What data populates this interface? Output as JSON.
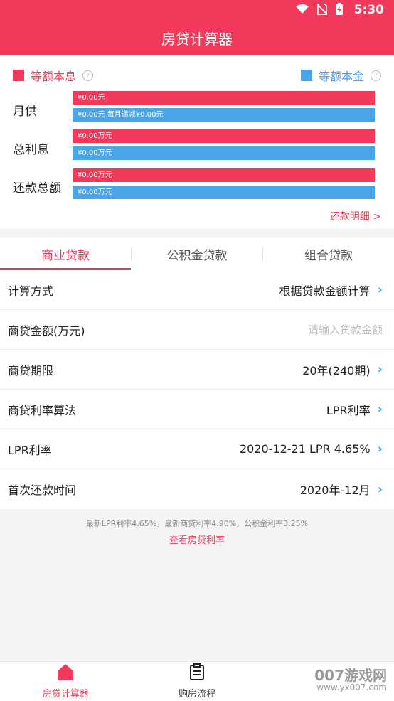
{
  "status_bar": {
    "time": "5:30",
    "icons": [
      "wifi-icon",
      "no-sim-icon",
      "battery-charging-icon"
    ]
  },
  "header": {
    "title": "房贷计算器"
  },
  "summary": {
    "legend_left": "等额本息",
    "legend_right": "等额本金",
    "legend_left_color": "#f2395b",
    "legend_right_color": "#4aa5e8",
    "rows": [
      {
        "label": "月供",
        "red": "¥0.00元",
        "blue": "¥0.00元  每月递减¥0.00元"
      },
      {
        "label": "总利息",
        "red": "¥0.00万元",
        "blue": "¥0.00万元"
      },
      {
        "label": "还款总额",
        "red": "¥0.00万元",
        "blue": "¥0.00万元"
      }
    ],
    "detail_link": "还款明细 >"
  },
  "tabs": [
    "商业贷款",
    "公积金贷款",
    "组合贷款"
  ],
  "form": [
    {
      "label": "计算方式",
      "value": "根据贷款金额计算",
      "chevron": true
    },
    {
      "label": "商贷金额(万元)",
      "placeholder": "请输入贷款金额"
    },
    {
      "label": "商贷期限",
      "value": "20年(240期)",
      "chevron": true
    },
    {
      "label": "商贷利率算法",
      "value": "LPR利率",
      "chevron": true
    },
    {
      "label": "LPR利率",
      "value": "2020-12-21 LPR 4.65%",
      "chevron": true
    },
    {
      "label": "首次还款时间",
      "value": "2020年-12月",
      "chevron": true
    }
  ],
  "note": "最新LPR利率4.65%，最新商贷利率4.90%，公积金利率3.25%",
  "rate_link": "查看房贷利率",
  "bottom_nav": [
    {
      "label": "房贷计算器",
      "icon": "house-icon"
    },
    {
      "label": "购房流程",
      "icon": "clipboard-icon"
    }
  ],
  "watermark": {
    "line1": "007游戏网",
    "line2": "www.yx007.com"
  }
}
